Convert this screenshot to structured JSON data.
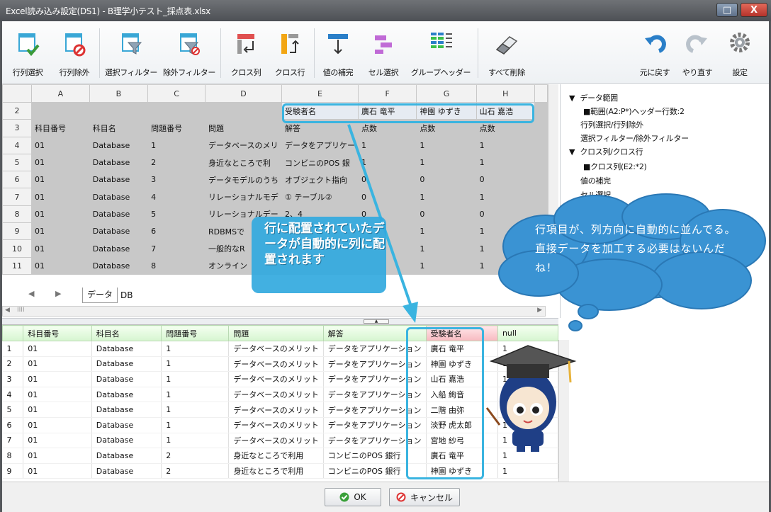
{
  "window": {
    "title": "Excel読み込み設定(DS1) - B理学小テスト_採点表.xlsx",
    "max_glyph": "□",
    "close_glyph": "X"
  },
  "toolbar": {
    "row_select": "行列選択",
    "row_exclude": "行列除外",
    "select_filter": "選択フィルター",
    "exclude_filter": "除外フィルター",
    "cross_col": "クロス列",
    "cross_row": "クロス行",
    "value_fill": "値の補完",
    "cell_select": "セル選択",
    "group_header": "グループヘッダー",
    "delete_all": "すべて削除",
    "undo": "元に戻す",
    "redo": "やり直す",
    "settings": "設定"
  },
  "sheet": {
    "col_letters": [
      "A",
      "B",
      "C",
      "D",
      "E",
      "F",
      "G",
      "H"
    ],
    "rows": [
      {
        "n": "2",
        "cells": [
          "",
          "",
          "",
          "",
          "受験者名",
          "廣石 竜平",
          "神園 ゆずき",
          "山石 嘉浩"
        ]
      },
      {
        "n": "3",
        "cells": [
          "科目番号",
          "科目名",
          "問題番号",
          "問題",
          "解答",
          "点数",
          "点数",
          "点数"
        ]
      },
      {
        "n": "4",
        "cells": [
          "01",
          "Database",
          "1",
          "データベースのメリ",
          "データをアプリケー",
          "1",
          "1",
          "1"
        ]
      },
      {
        "n": "5",
        "cells": [
          "01",
          "Database",
          "2",
          "身近なところで利",
          "コンビニのPOS 銀",
          "1",
          "1",
          "1"
        ]
      },
      {
        "n": "6",
        "cells": [
          "01",
          "Database",
          "3",
          "データモデルのうち",
          "オブジェクト指向",
          "0",
          "0",
          "0"
        ]
      },
      {
        "n": "7",
        "cells": [
          "01",
          "Database",
          "4",
          "リレーショナルモデ",
          "① テーブル②",
          "0",
          "1",
          "1"
        ]
      },
      {
        "n": "8",
        "cells": [
          "01",
          "Database",
          "5",
          "リレーショナルデー",
          "2、4",
          "0",
          "0",
          "0"
        ]
      },
      {
        "n": "9",
        "cells": [
          "01",
          "Database",
          "6",
          "RDBMSで",
          "",
          "",
          "1",
          "1"
        ]
      },
      {
        "n": "10",
        "cells": [
          "01",
          "Database",
          "7",
          "一般的なR",
          "",
          "",
          "1",
          "1"
        ]
      },
      {
        "n": "11",
        "cells": [
          "01",
          "Database",
          "8",
          "オンライン",
          "",
          "",
          "1",
          "1"
        ]
      }
    ],
    "tab_active": "データ",
    "tab_other": "DB",
    "hscroll_mark": "IIII"
  },
  "tree": {
    "items": [
      {
        "label": "データ範囲",
        "toggle": "▼"
      },
      {
        "label": "■範囲(A2:P*)ヘッダー行数:2"
      },
      {
        "label": "行列選択/行列除外"
      },
      {
        "label": "選択フィルター/除外フィルター"
      },
      {
        "label": "クロス列/クロス行",
        "toggle": "▼"
      },
      {
        "label": "■クロス列(E2:*2)"
      },
      {
        "label": "値の補完"
      },
      {
        "label": "セル選択"
      }
    ]
  },
  "preview": {
    "headers": [
      "科目番号",
      "科目名",
      "問題番号",
      "問題",
      "解答",
      "受験者名",
      "null"
    ],
    "rows": [
      [
        "1",
        "01",
        "Database",
        "1",
        "データベースのメリット",
        "データをアプリケーション",
        "廣石 竜平",
        "1"
      ],
      [
        "2",
        "01",
        "Database",
        "1",
        "データベースのメリット",
        "データをアプリケーション",
        "神園 ゆずき",
        "1"
      ],
      [
        "3",
        "01",
        "Database",
        "1",
        "データベースのメリット",
        "データをアプリケーション",
        "山石 嘉浩",
        "1"
      ],
      [
        "4",
        "01",
        "Database",
        "1",
        "データベースのメリット",
        "データをアプリケーション",
        "入船 絢音",
        "1"
      ],
      [
        "5",
        "01",
        "Database",
        "1",
        "データベースのメリット",
        "データをアプリケーション",
        "二階 由弥",
        "1"
      ],
      [
        "6",
        "01",
        "Database",
        "1",
        "データベースのメリット",
        "データをアプリケーション",
        "淡野 虎太郎",
        "1"
      ],
      [
        "7",
        "01",
        "Database",
        "1",
        "データベースのメリット",
        "データをアプリケーション",
        "宮地 紗弓",
        "1"
      ],
      [
        "8",
        "01",
        "Database",
        "2",
        "身近なところで利用",
        "コンビニのPOS 銀行",
        "廣石 竜平",
        "1"
      ],
      [
        "9",
        "01",
        "Database",
        "2",
        "身近なところで利用",
        "コンビニのPOS 銀行",
        "神園 ゆずき",
        "1"
      ]
    ]
  },
  "footer": {
    "ok": "OK",
    "cancel": "キャンセル"
  },
  "annotations": {
    "callout": "行に配置されていたデータが自動的に列に配置されます",
    "cloud": "行項目が、列方向に自動的に並んでる。直接データを加工する必要はないんだね！"
  },
  "colors": {
    "accent": "#3ab4e0",
    "highlight_header": "#f7b9c0",
    "selection": "#c8c8c8"
  }
}
